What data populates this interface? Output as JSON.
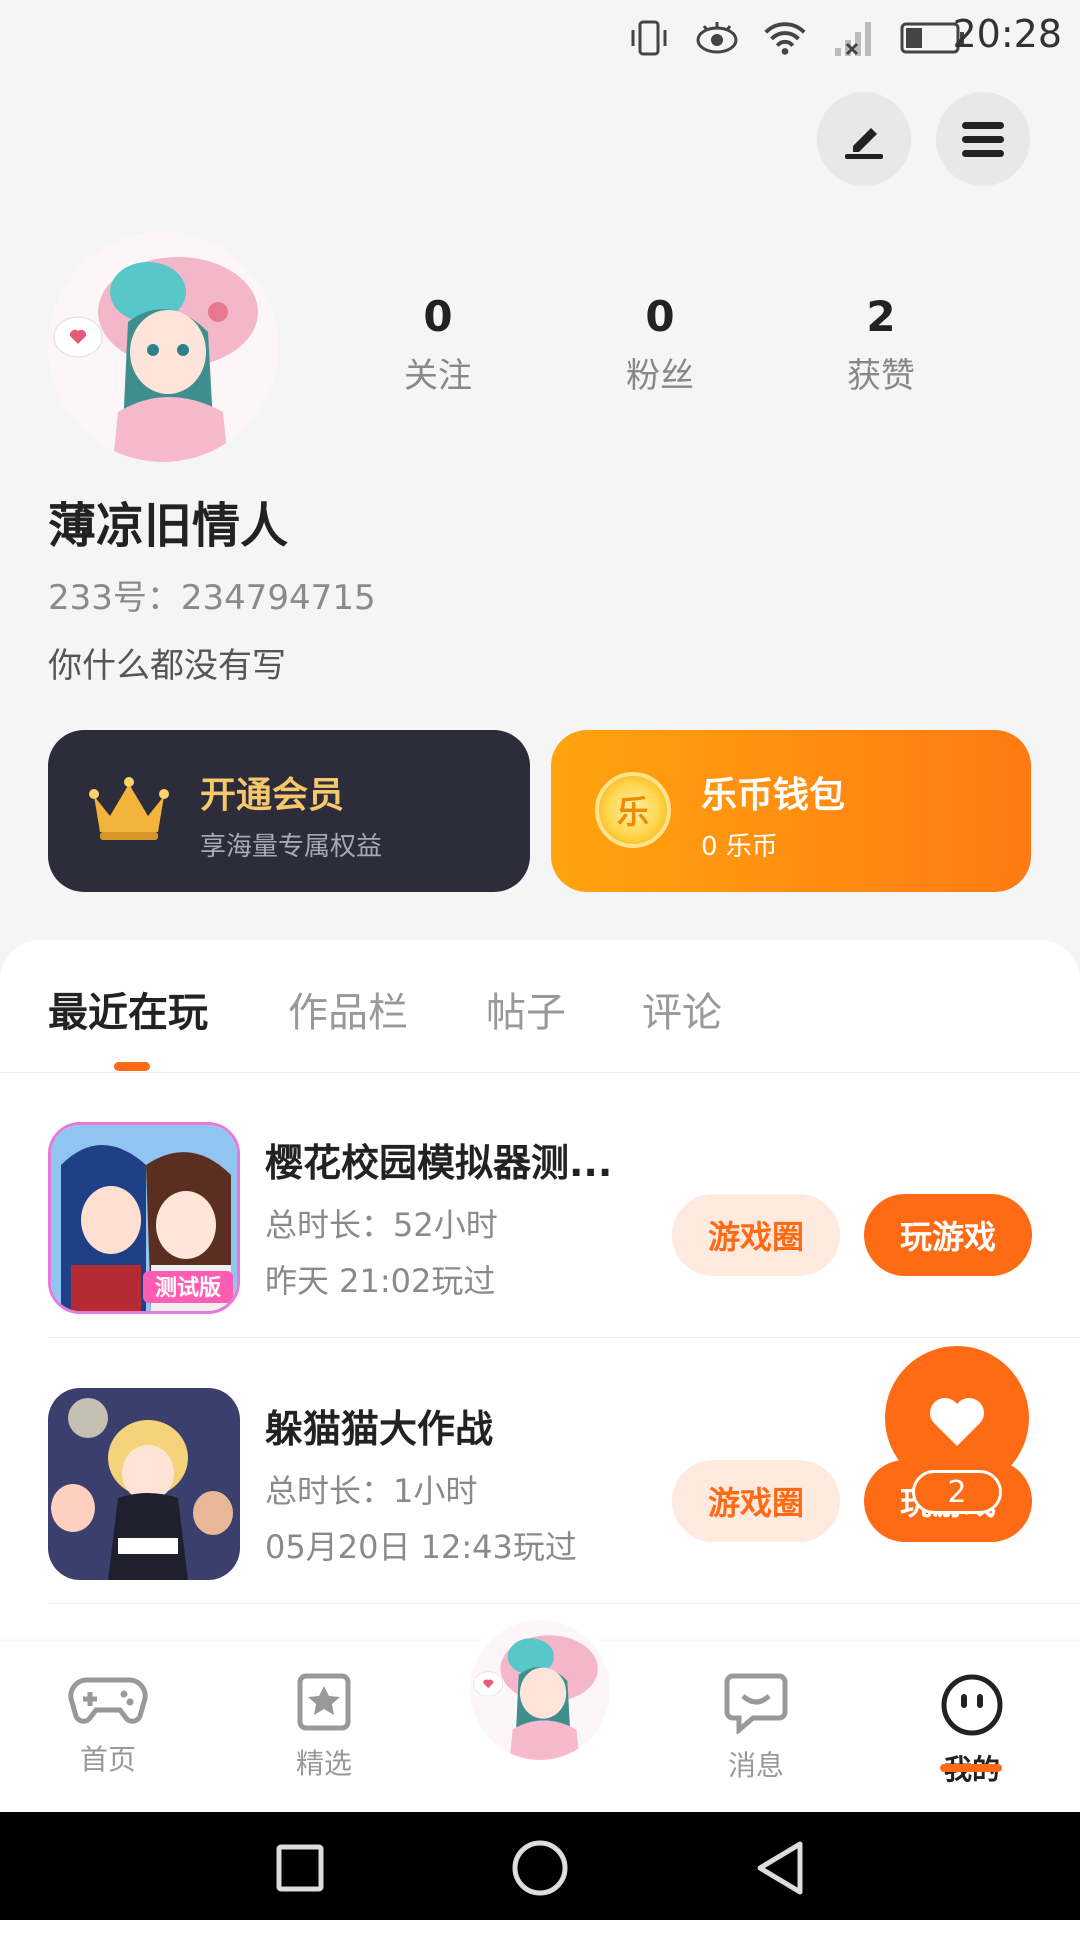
{
  "status_bar": {
    "time": "20:28"
  },
  "profile": {
    "stats": [
      {
        "num": "0",
        "label": "关注"
      },
      {
        "num": "0",
        "label": "粉丝"
      },
      {
        "num": "2",
        "label": "获赞"
      }
    ],
    "username": "薄凉旧情人",
    "user_id": "233号：234794715",
    "bio": "你什么都没有写"
  },
  "cards": {
    "vip": {
      "title": "开通会员",
      "subtitle": "享海量专属权益"
    },
    "wallet": {
      "title": "乐币钱包",
      "subtitle": "0 乐币",
      "coin_char": "乐"
    }
  },
  "tabs": [
    "最近在玩",
    "作品栏",
    "帖子",
    "评论"
  ],
  "games": [
    {
      "name": "樱花校园模拟器测...",
      "duration": "总时长：52小时",
      "last_played": "昨天 21:02玩过",
      "circle_btn": "游戏圈",
      "play_btn": "玩游戏"
    },
    {
      "name": "躲猫猫大作战",
      "duration": "总时长：1小时",
      "last_played": "05月20日 12:43玩过",
      "circle_btn": "游戏圈",
      "play_btn": "玩游戏"
    }
  ],
  "like_fab": {
    "count": "2"
  },
  "bottom_nav": {
    "home": "首页",
    "featured": "精选",
    "messages": "消息",
    "me": "我的"
  },
  "accent_color": "#ff6a14"
}
